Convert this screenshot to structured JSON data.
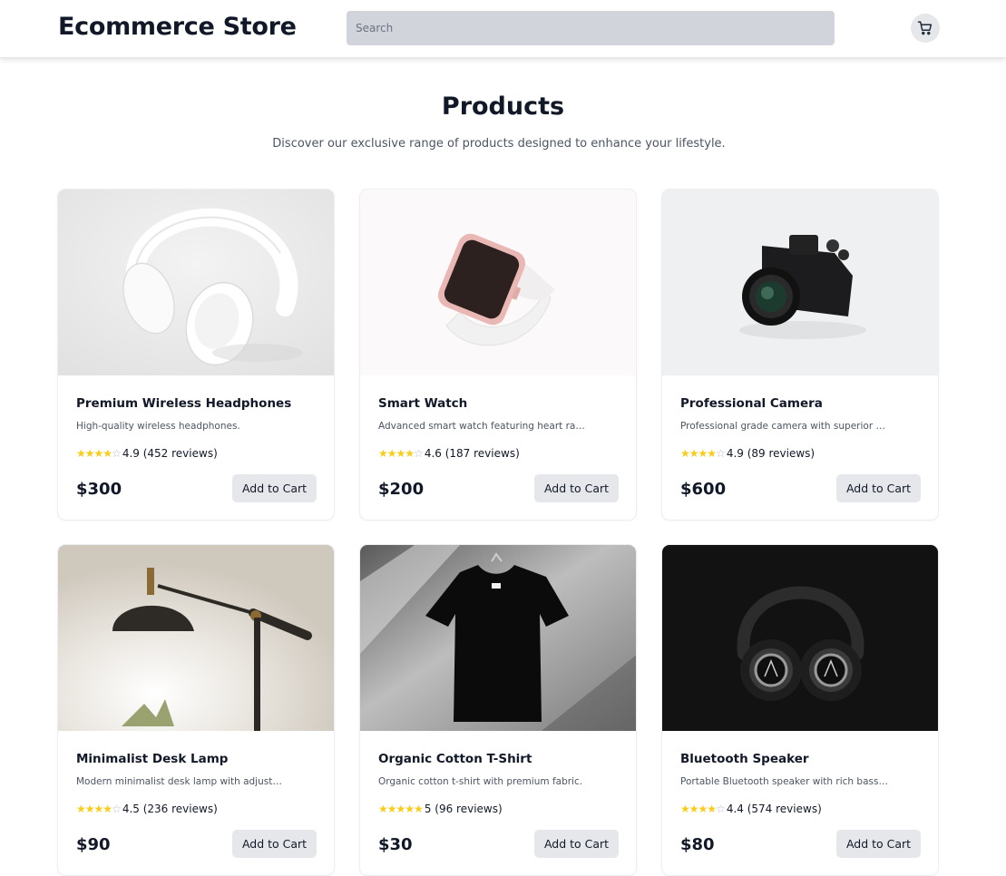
{
  "header": {
    "brand": "Ecommerce Store",
    "search_placeholder": "Search",
    "cart_icon": "shopping-cart-icon"
  },
  "hero": {
    "title": "Products",
    "subtitle": "Discover our exclusive range of products designed to enhance your lifestyle."
  },
  "colors": {
    "star": "#facc15",
    "button_bg": "#e5e7eb",
    "search_bg": "#d1d5db",
    "text": "#111827"
  },
  "products": [
    {
      "name": "Premium Wireless Headphones",
      "description": "High-quality wireless headphones.",
      "stars_filled": 4,
      "rating_text": "4.9 (452 reviews)",
      "price": "$300",
      "button": "Add to Cart",
      "image": "white-headphones-image"
    },
    {
      "name": "Smart Watch",
      "description": "Advanced smart watch featuring heart rate...",
      "stars_filled": 4,
      "rating_text": "4.6 (187 reviews)",
      "price": "$200",
      "button": "Add to Cart",
      "image": "smart-watch-image"
    },
    {
      "name": "Professional Camera",
      "description": "Professional grade camera with superior optics.",
      "stars_filled": 4,
      "rating_text": "4.9 (89 reviews)",
      "price": "$600",
      "button": "Add to Cart",
      "image": "camera-image"
    },
    {
      "name": "Minimalist Desk Lamp",
      "description": "Modern minimalist desk lamp with adjustable...",
      "stars_filled": 4,
      "rating_text": "4.5 (236 reviews)",
      "price": "$90",
      "button": "Add to Cart",
      "image": "desk-lamp-image"
    },
    {
      "name": "Organic Cotton T-Shirt",
      "description": "Organic cotton t-shirt with premium fabric.",
      "stars_filled": 5,
      "rating_text": "5 (96 reviews)",
      "price": "$30",
      "button": "Add to Cart",
      "image": "black-tshirt-image"
    },
    {
      "name": "Bluetooth Speaker",
      "description": "Portable Bluetooth speaker with rich bass and crysta...",
      "stars_filled": 4,
      "rating_text": "4.4 (574 reviews)",
      "price": "$80",
      "button": "Add to Cart",
      "image": "black-headphones-image"
    }
  ]
}
